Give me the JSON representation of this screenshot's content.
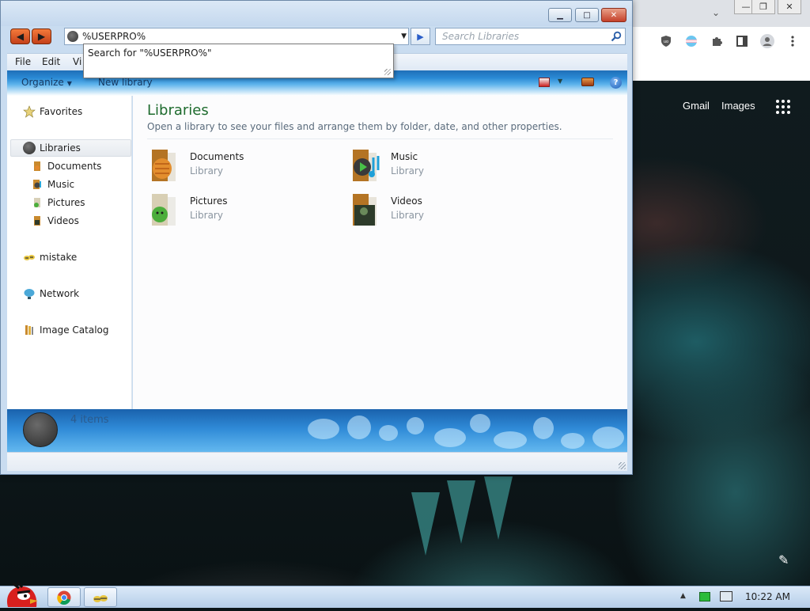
{
  "explorer": {
    "address": {
      "value": "%USERPRO%"
    },
    "search": {
      "placeholder": "Search Libraries"
    },
    "suggestion": "Search for \"%USERPRO%\"",
    "menu": [
      "File",
      "Edit",
      "Vi"
    ],
    "toolbar": {
      "organize": "Organize",
      "new_library": "New library"
    },
    "nav": {
      "favorites": "Favorites",
      "libraries": "Libraries",
      "documents": "Documents",
      "music": "Music",
      "pictures": "Pictures",
      "videos": "Videos",
      "mistake": "mistake",
      "network": "Network",
      "image_catalog": "Image Catalog"
    },
    "content": {
      "title": "Libraries",
      "subtitle": "Open a library to see your files and arrange them by folder, date, and other properties.",
      "libraries": [
        {
          "name": "Documents",
          "type": "Library",
          "icon": "documents-folder-icon"
        },
        {
          "name": "Music",
          "type": "Library",
          "icon": "music-folder-icon"
        },
        {
          "name": "Pictures",
          "type": "Library",
          "icon": "pictures-folder-icon"
        },
        {
          "name": "Videos",
          "type": "Library",
          "icon": "videos-folder-icon"
        }
      ]
    },
    "details": {
      "item_count": "4 items"
    }
  },
  "browser": {
    "gmail": "Gmail",
    "images": "Images"
  },
  "taskbar": {
    "clock": "10:22 AM",
    "pinned": [
      "chrome-icon",
      "explorer-icon"
    ]
  },
  "colors": {
    "accent_orange": "#d9531e",
    "title_green": "#1e6b2e",
    "toolbar_blue": "#2a8ad5",
    "selection_gray": "#e6eaef"
  }
}
